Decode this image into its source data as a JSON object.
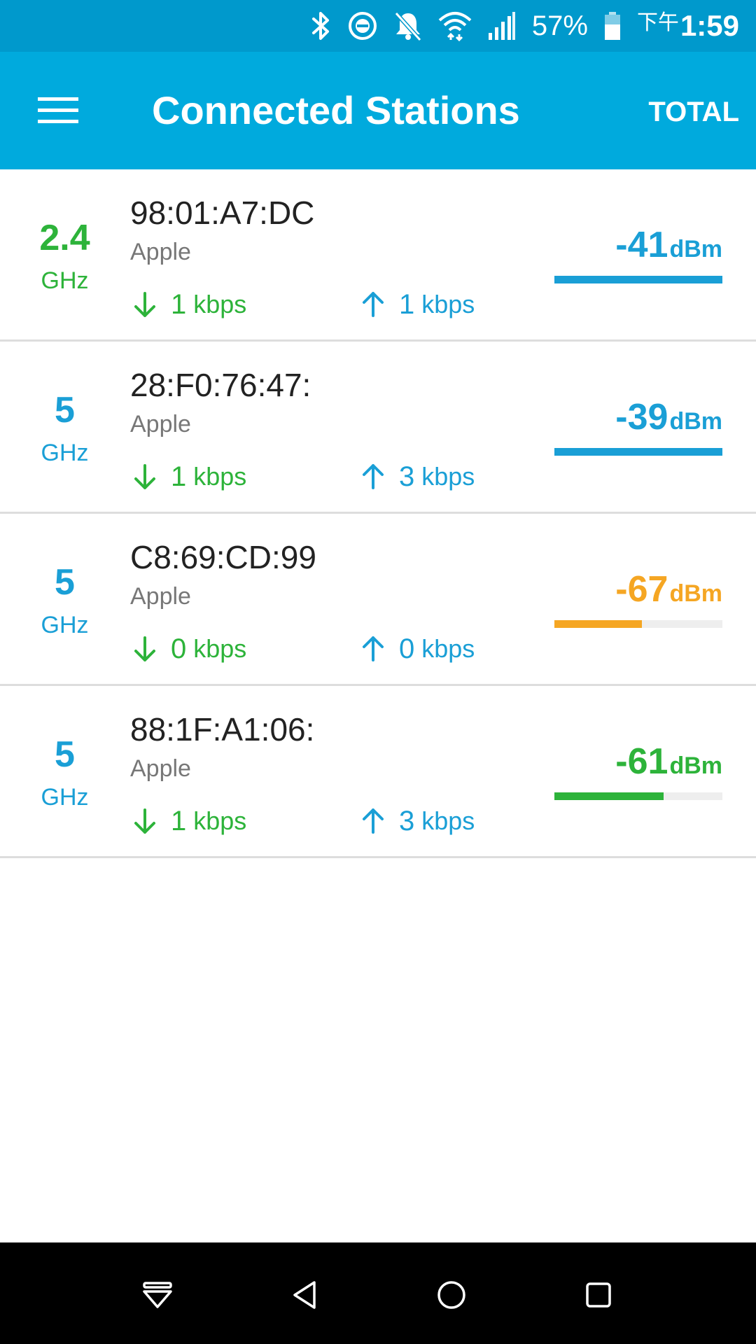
{
  "status_bar": {
    "battery_text": "57%",
    "time_prefix": "下午",
    "time": "1:59",
    "icons": [
      "bluetooth-icon",
      "dnd-icon",
      "bell-off-icon",
      "wifi-icon",
      "signal-icon",
      "battery-icon"
    ]
  },
  "app_bar": {
    "title": "Connected Stations",
    "action_label": "TOTAL",
    "menu_icon": "hamburger-menu-icon"
  },
  "stations": [
    {
      "band": "2.4",
      "band_unit": "GHz",
      "band_color": "#2db33a",
      "mac": "98:01:A7:DC",
      "vendor": "Apple",
      "down": "1",
      "down_unit": "kbps",
      "up": "1",
      "up_unit": "kbps",
      "signal": "-41",
      "signal_unit": "dBm",
      "signal_color": "#1a9fd6",
      "signal_fraction": 1.0
    },
    {
      "band": "5",
      "band_unit": "GHz",
      "band_color": "#1a9fd6",
      "mac": "28:F0:76:47:",
      "vendor": "Apple",
      "down": "1",
      "down_unit": "kbps",
      "up": "3",
      "up_unit": "kbps",
      "signal": "-39",
      "signal_unit": "dBm",
      "signal_color": "#1a9fd6",
      "signal_fraction": 1.0
    },
    {
      "band": "5",
      "band_unit": "GHz",
      "band_color": "#1a9fd6",
      "mac": "C8:69:CD:99",
      "vendor": "Apple",
      "down": "0",
      "down_unit": "kbps",
      "up": "0",
      "up_unit": "kbps",
      "signal": "-67",
      "signal_unit": "dBm",
      "signal_color": "#f5a623",
      "signal_fraction": 0.52
    },
    {
      "band": "5",
      "band_unit": "GHz",
      "band_color": "#1a9fd6",
      "mac": "88:1F:A1:06:",
      "vendor": "Apple",
      "down": "1",
      "down_unit": "kbps",
      "up": "3",
      "up_unit": "kbps",
      "signal": "-61",
      "signal_unit": "dBm",
      "signal_color": "#2db33a",
      "signal_fraction": 0.65
    }
  ],
  "nav_bar": {
    "icons": [
      "hide-keyboard-icon",
      "back-icon",
      "home-icon",
      "recents-icon"
    ]
  },
  "colors": {
    "status_bar": "#0099cc",
    "app_bar": "#00aadd",
    "download": "#2db33a",
    "upload": "#1a9fd6"
  }
}
